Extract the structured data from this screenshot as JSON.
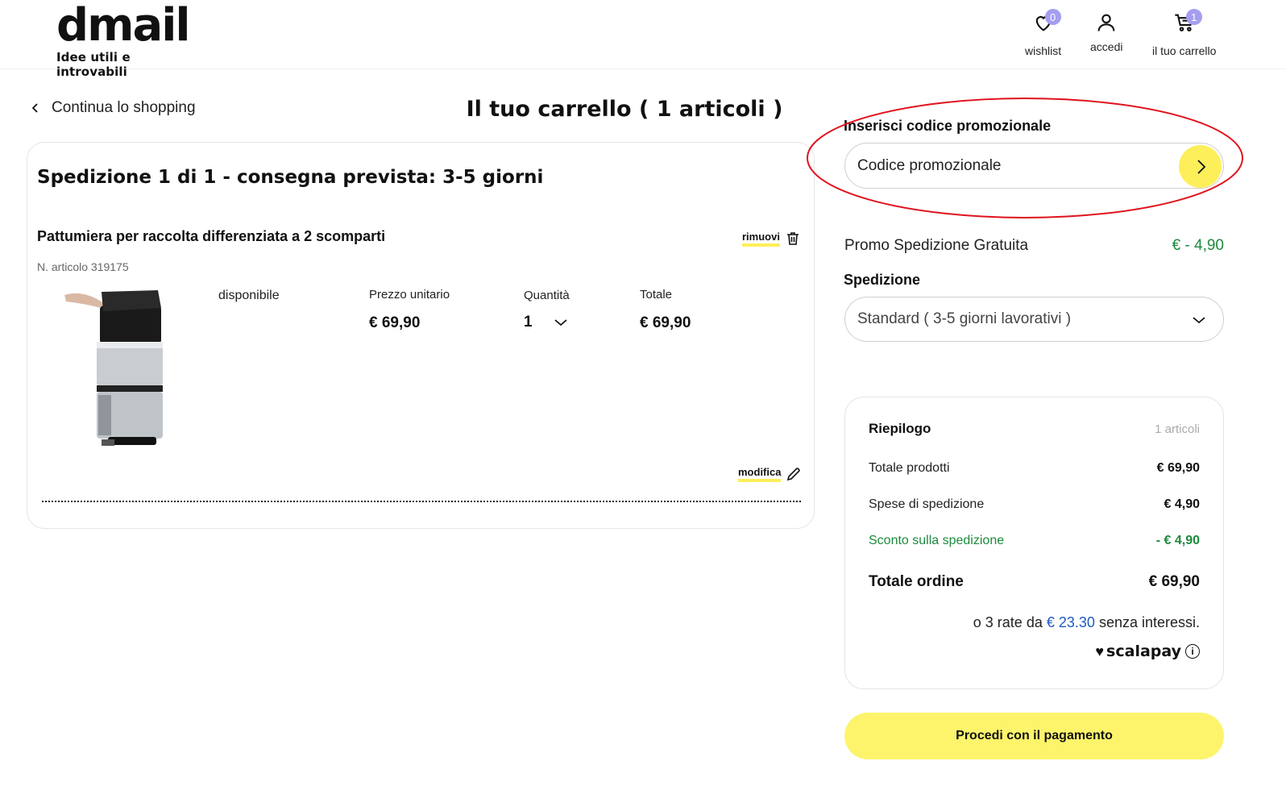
{
  "header": {
    "logo": {
      "name": "dmail",
      "tagline": "Idee utili e introvabili"
    },
    "nav": {
      "wishlist": {
        "label": "wishlist",
        "badge": "0"
      },
      "account": {
        "label": "accedi"
      },
      "cart": {
        "label": "il tuo carrello",
        "badge": "1"
      }
    }
  },
  "back_link": "Continua lo shopping",
  "page_title": "Il tuo carrello ( 1 articoli )",
  "shipment": {
    "title": "Spedizione 1 di 1 - consegna prevista: 3-5 giorni",
    "item": {
      "name": "Pattumiera per raccolta differenziata a 2 scomparti",
      "code": "N. articolo 319175",
      "availability": "disponibile",
      "remove_label": "rimuovi",
      "edit_label": "modifica",
      "columns": {
        "unit_price_label": "Prezzo unitario",
        "quantity_label": "Quantità",
        "total_label": "Totale"
      },
      "unit_price": "€ 69,90",
      "quantity": "1",
      "total": "€ 69,90"
    }
  },
  "promo": {
    "label": "Inserisci codice promozionale",
    "placeholder": "Codice promozionale",
    "applied_name": "Promo Spedizione Gratuita",
    "applied_value": "€ - 4,90"
  },
  "shipping": {
    "label": "Spedizione",
    "selected": "Standard ( 3-5 giorni lavorativi )"
  },
  "summary": {
    "title": "Riepilogo",
    "count": "1 articoli",
    "rows": [
      {
        "label": "Totale prodotti",
        "value": "€ 69,90"
      },
      {
        "label": "Spese di spedizione",
        "value": "€ 4,90"
      },
      {
        "label": "Sconto sulla spedizione",
        "value": "- € 4,90"
      }
    ],
    "total_label": "Totale ordine",
    "total_value": "€ 69,90",
    "installments_prefix": "o 3 rate da",
    "installments_amount": "€ 23.30",
    "installments_suffix": "senza interessi.",
    "provider": "scalapay"
  },
  "checkout_button": "Procedi con il pagamento",
  "colors": {
    "accent_yellow": "#fdef5a",
    "discount_green": "#1c8a3c",
    "badge_purple": "#a59ef0",
    "annotation_red": "#e0141e",
    "installment_blue": "#1e5bc6"
  }
}
